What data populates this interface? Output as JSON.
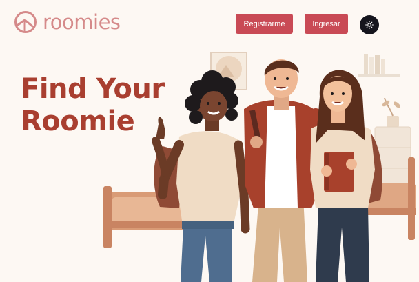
{
  "brand": {
    "name": "roomies",
    "logo_icon": "roomies-logo-icon"
  },
  "header": {
    "register_label": "Registrarme",
    "login_label": "Ingresar",
    "theme_icon": "sun-icon"
  },
  "hero": {
    "title_line1": "Find Your",
    "title_line2": "Roomie",
    "illustration": "three-roommates-illustration"
  },
  "colors": {
    "background": "#fdf8f3",
    "accent": "#c94a55",
    "title": "#a93f30",
    "logo": "#d58a8a",
    "toggle": "#15151d"
  }
}
